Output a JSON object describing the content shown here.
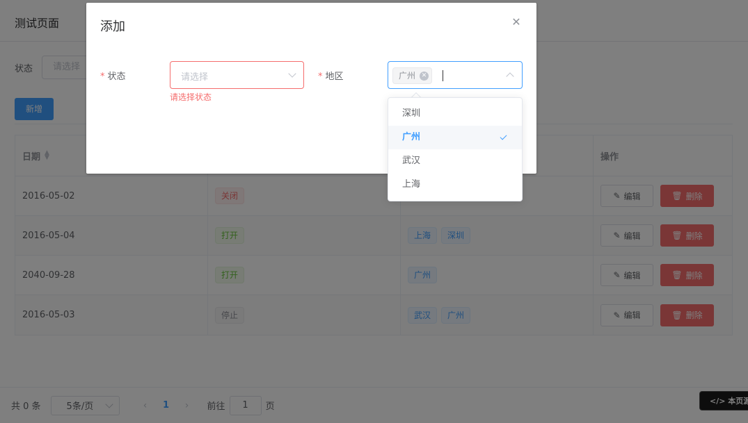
{
  "page": {
    "title": "测试页面"
  },
  "filter": {
    "label": "状态",
    "placeholder": "请选择"
  },
  "actions": {
    "add_label": "新增"
  },
  "table": {
    "headers": {
      "date": "日期",
      "ops": "操作"
    },
    "rows": [
      {
        "date": "2016-05-02",
        "state": "关闭",
        "regions": [],
        "edit": "编辑",
        "delete": "删除"
      },
      {
        "date": "2016-05-04",
        "state": "打开",
        "regions": [
          "上海",
          "深圳"
        ],
        "edit": "编辑",
        "delete": "删除"
      },
      {
        "date": "2040-09-28",
        "state": "打开",
        "regions": [
          "广州"
        ],
        "edit": "编辑",
        "delete": "删除"
      },
      {
        "date": "2016-05-03",
        "state": "停止",
        "regions": [
          "武汉",
          "广州"
        ],
        "edit": "编辑",
        "delete": "删除"
      }
    ]
  },
  "pager": {
    "total": "共 0 条",
    "page_size": "5条/页",
    "current": "1",
    "goto_prefix": "前往",
    "goto_value": "1",
    "goto_suffix": "页"
  },
  "source_button": "</> 本页源码",
  "dialog": {
    "title": "添加",
    "state": {
      "label": "状态",
      "required": "*",
      "placeholder": "请选择",
      "error": "请选择状态"
    },
    "region": {
      "label": "地区",
      "required": "*",
      "selected_tag": "广州"
    },
    "options": [
      "深圳",
      "广州",
      "武汉",
      "上海"
    ],
    "selected_option": "广州"
  },
  "colors": {
    "primary": "#409eff",
    "danger": "#f56c6c",
    "success": "#67c23a",
    "info": "#909399"
  }
}
